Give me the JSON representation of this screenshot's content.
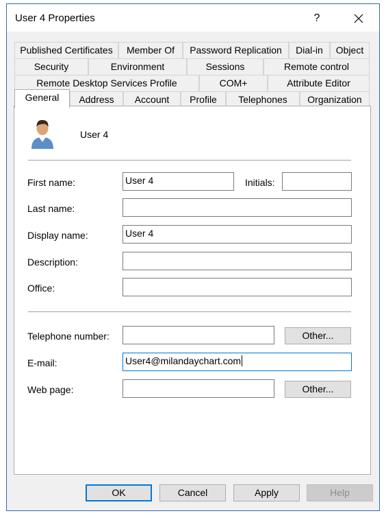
{
  "window": {
    "title": "User 4 Properties",
    "help_label": "?"
  },
  "tabs": {
    "row1": [
      "Published Certificates",
      "Member Of",
      "Password Replication",
      "Dial-in",
      "Object"
    ],
    "row2": [
      "Security",
      "Environment",
      "Sessions",
      "Remote control"
    ],
    "row3": [
      "Remote Desktop Services Profile",
      "COM+",
      "Attribute Editor"
    ],
    "row4": [
      "General",
      "Address",
      "Account",
      "Profile",
      "Telephones",
      "Organization"
    ],
    "active": "General"
  },
  "general": {
    "user_name": "User 4",
    "first_name": {
      "label": "First name:",
      "value": "User 4"
    },
    "initials": {
      "label": "Initials:",
      "value": ""
    },
    "last_name": {
      "label": "Last name:",
      "value": ""
    },
    "display_name": {
      "label": "Display name:",
      "value": "User 4"
    },
    "description": {
      "label": "Description:",
      "value": ""
    },
    "office": {
      "label": "Office:",
      "value": ""
    },
    "telephone": {
      "label": "Telephone number:",
      "value": "",
      "other_label": "Other..."
    },
    "email": {
      "label": "E-mail:",
      "value": "User4@milandaychart.com"
    },
    "web_page": {
      "label": "Web page:",
      "value": "",
      "other_label": "Other..."
    }
  },
  "buttons": {
    "ok": "OK",
    "cancel": "Cancel",
    "apply": "Apply",
    "help": "Help"
  },
  "colors": {
    "accent": "#0078d7",
    "dialog_border": "#2b6cb0",
    "face": "#f0f0f0"
  }
}
